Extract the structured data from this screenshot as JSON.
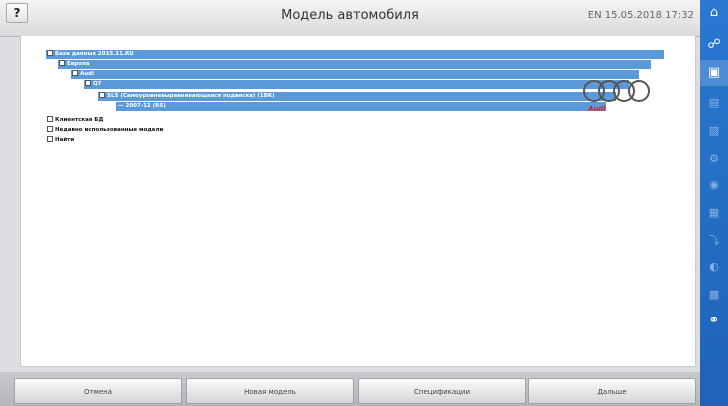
{
  "title_bar": {
    "help_label": "?",
    "title": "Модель автомобиля",
    "status": "EN 15.05.2018 17:32"
  },
  "tree": [
    {
      "label": "База данных 2015.11.RU",
      "selected": true
    },
    {
      "label": "Европа",
      "selected": true
    },
    {
      "label": "Audi",
      "selected": true
    },
    {
      "label": "Q7",
      "selected": true
    },
    {
      "label": "SLS (Самоуровневыравнивающаяся подвеска) (1BK)",
      "selected": true
    },
    {
      "label": "2007-12 (RS)",
      "selected": true
    },
    {
      "label": "Клиентская БД",
      "selected": false
    },
    {
      "label": "Недавно использованные модели",
      "selected": false
    },
    {
      "label": "Найти",
      "selected": false
    }
  ],
  "brand": {
    "name": "Audi",
    "color": "#d81f26"
  },
  "toolbar": {
    "cancel_label": "Отмена",
    "new_model_label": "Новая модель",
    "specs_label": "Спецификации",
    "next_label": "Дальше"
  },
  "sidebar_icons": [
    "home-icon",
    "person-icon",
    "car-icon",
    "list-icon",
    "card-icon",
    "gear-icon",
    "settings-icon",
    "document-icon",
    "plug-icon",
    "globe-icon",
    "print-icon",
    "connect-icon"
  ],
  "colors": {
    "accent": "#2a78d0",
    "selection": "#5b9ad8"
  }
}
